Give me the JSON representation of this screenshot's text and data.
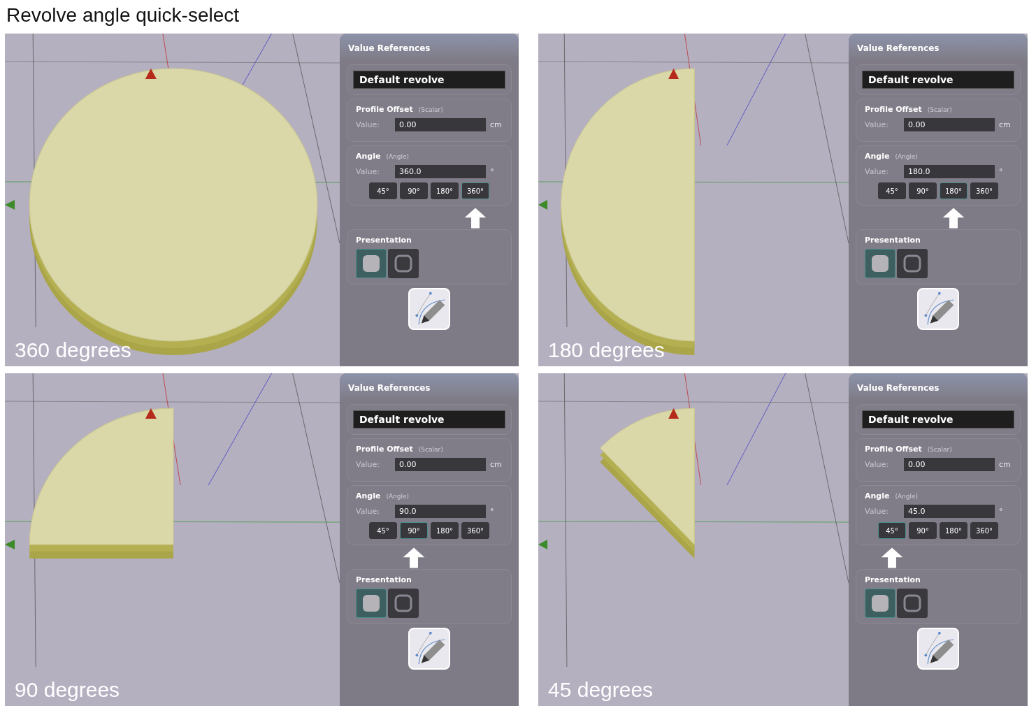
{
  "title": "Revolve angle quick-select",
  "panels": [
    {
      "caption": "360 degrees",
      "panel_title": "Value References",
      "preset_name": "Default revolve",
      "profile_offset": {
        "label": "Profile Offset",
        "type": "(Scalar)",
        "value_label": "Value:",
        "value": "0.00",
        "unit": "cm"
      },
      "angle": {
        "label": "Angle",
        "type": "(Angle)",
        "value_label": "Value:",
        "value": "360.0",
        "unit": "°",
        "presets": [
          {
            "label": "45°",
            "selected": false
          },
          {
            "label": "90°",
            "selected": false
          },
          {
            "label": "180°",
            "selected": false
          },
          {
            "label": "360°",
            "selected": true
          }
        ]
      },
      "presentation": {
        "label": "Presentation",
        "modes": [
          {
            "kind": "solid",
            "selected": true
          },
          {
            "kind": "outline",
            "selected": false
          }
        ]
      }
    },
    {
      "caption": "180 degrees",
      "panel_title": "Value References",
      "preset_name": "Default revolve",
      "profile_offset": {
        "label": "Profile Offset",
        "type": "(Scalar)",
        "value_label": "Value:",
        "value": "0.00",
        "unit": "cm"
      },
      "angle": {
        "label": "Angle",
        "type": "(Angle)",
        "value_label": "Value:",
        "value": "180.0",
        "unit": "°",
        "presets": [
          {
            "label": "45°",
            "selected": false
          },
          {
            "label": "90°",
            "selected": false
          },
          {
            "label": "180°",
            "selected": true
          },
          {
            "label": "360°",
            "selected": false
          }
        ]
      },
      "presentation": {
        "label": "Presentation",
        "modes": [
          {
            "kind": "solid",
            "selected": true
          },
          {
            "kind": "outline",
            "selected": false
          }
        ]
      }
    },
    {
      "caption": "90 degrees",
      "panel_title": "Value References",
      "preset_name": "Default revolve",
      "profile_offset": {
        "label": "Profile Offset",
        "type": "(Scalar)",
        "value_label": "Value:",
        "value": "0.00",
        "unit": "cm"
      },
      "angle": {
        "label": "Angle",
        "type": "(Angle)",
        "value_label": "Value:",
        "value": "90.0",
        "unit": "°",
        "presets": [
          {
            "label": "45°",
            "selected": false
          },
          {
            "label": "90°",
            "selected": true
          },
          {
            "label": "180°",
            "selected": false
          },
          {
            "label": "360°",
            "selected": false
          }
        ]
      },
      "presentation": {
        "label": "Presentation",
        "modes": [
          {
            "kind": "solid",
            "selected": true
          },
          {
            "kind": "outline",
            "selected": false
          }
        ]
      }
    },
    {
      "caption": "45 degrees",
      "panel_title": "Value References",
      "preset_name": "Default revolve",
      "profile_offset": {
        "label": "Profile Offset",
        "type": "(Scalar)",
        "value_label": "Value:",
        "value": "0.00",
        "unit": "cm"
      },
      "angle": {
        "label": "Angle",
        "type": "(Angle)",
        "value_label": "Value:",
        "value": "45.0",
        "unit": "°",
        "presets": [
          {
            "label": "45°",
            "selected": true
          },
          {
            "label": "90°",
            "selected": false
          },
          {
            "label": "180°",
            "selected": false
          },
          {
            "label": "360°",
            "selected": false
          }
        ]
      },
      "presentation": {
        "label": "Presentation",
        "modes": [
          {
            "kind": "solid",
            "selected": true
          },
          {
            "kind": "outline",
            "selected": false
          }
        ]
      }
    }
  ]
}
